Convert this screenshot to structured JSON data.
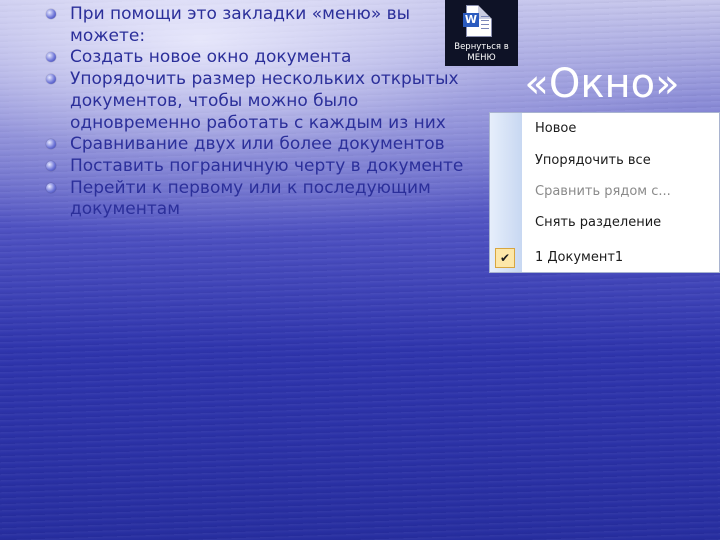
{
  "bullets": [
    "При помощи это закладки «меню» вы можете:",
    "Создать новое окно документа",
    "Упорядочить размер нескольких открытых документов, чтобы можно было одновременно работать с каждым из них",
    "Сравнивание двух или более документов",
    "Поставить пограничную черту в документе",
    "Перейти к первому или к последующим документам"
  ],
  "back_button": {
    "icon": "word-document-icon",
    "label": "Вернуться в МЕНЮ"
  },
  "title": "«Окно»",
  "menu": {
    "items": [
      {
        "label": "Новое",
        "enabled": true
      },
      {
        "label": "Упорядочить все",
        "enabled": true
      },
      {
        "label": "Сравнить рядом с...",
        "enabled": false
      },
      {
        "label": "Снять разделение",
        "enabled": true
      },
      {
        "label": "1 Документ1",
        "enabled": true,
        "checked": true
      }
    ],
    "check_icon": "checkmark-icon"
  },
  "colors": {
    "bullet_text": "#2b2f9a",
    "title_text": "#ffffff"
  }
}
